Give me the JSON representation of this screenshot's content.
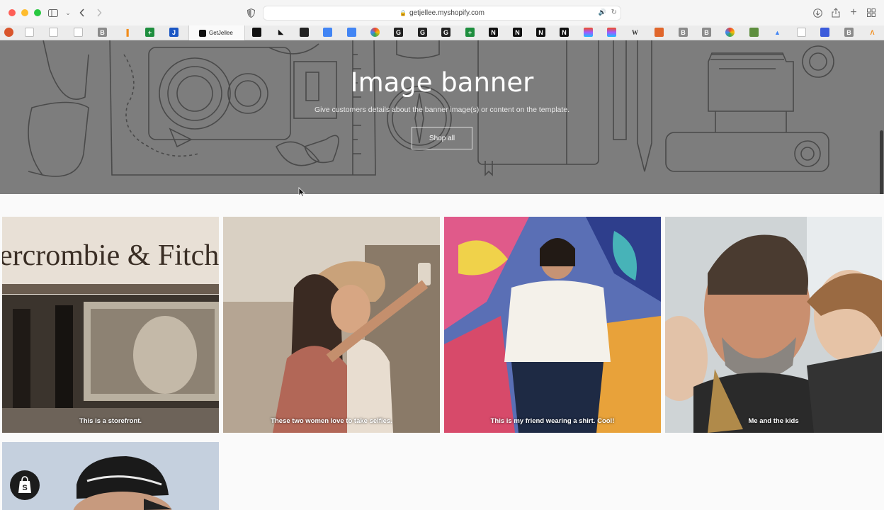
{
  "browser": {
    "url": "getjellee.myshopify.com",
    "active_tab_title": "GetJellee",
    "bookmark_icons": [
      "bookmark-favicon",
      "bookmark-favicon",
      "bookmark-favicon",
      "bookmark-favicon",
      "bookmark-favicon",
      "bookmark-favicon",
      "bookmark-favicon",
      "bookmark-favicon"
    ],
    "bookmark_letters": {
      "b1": "B",
      "w": "W",
      "n": "N",
      "g": "G"
    }
  },
  "banner": {
    "title": "Image banner",
    "subtitle": "Give customers details about the banner image(s) or content on the template.",
    "button_label": "Shop all"
  },
  "gallery": [
    {
      "caption": "This is a storefront."
    },
    {
      "caption": "These two women love to take selfies."
    },
    {
      "caption": "This is my friend wearing a shirt. Cool!"
    },
    {
      "caption": "Me and the kids"
    },
    {
      "caption": ""
    }
  ],
  "colors": {
    "banner_bg": "#7d7d7d",
    "page_bg": "#fafafa"
  }
}
